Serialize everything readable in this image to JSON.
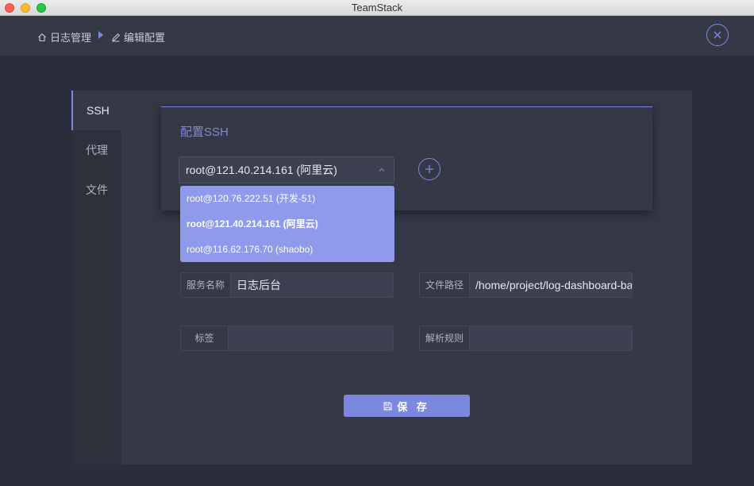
{
  "window": {
    "title": "TeamStack"
  },
  "breadcrumb": {
    "home_label": "日志管理",
    "current_label": "编辑配置"
  },
  "sidebar": {
    "items": [
      {
        "label": "SSH",
        "active": true
      },
      {
        "label": "代理"
      },
      {
        "label": "文件"
      }
    ]
  },
  "ssh": {
    "title": "配置SSH",
    "selected": "root@121.40.214.161 (阿里云)",
    "options": [
      "root@120.76.222.51 (开发-51)",
      "root@121.40.214.161 (阿里云)",
      "root@116.62.176.70 (shaobo)"
    ]
  },
  "form": {
    "service_name_label": "服务名称",
    "service_name_value": "日志后台",
    "file_path_label": "文件路径",
    "file_path_value": "/home/project/log-dashboard-ba",
    "tag_label": "标签",
    "tag_value": "",
    "parse_rule_label": "解析规则",
    "parse_rule_value": ""
  },
  "save_label": "保 存",
  "colors": {
    "accent": "#7c88e0",
    "dropdown": "#8f9bea",
    "panel": "#353946",
    "background": "#2a2e3a"
  }
}
